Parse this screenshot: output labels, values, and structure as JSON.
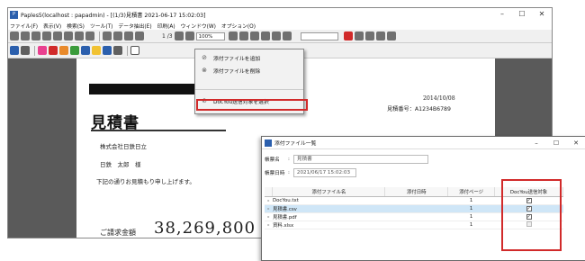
{
  "window": {
    "title": "Paples5(localhost : papadmin) - [(1/3)見積書 2021-06-17 15:02:03]",
    "controls": [
      "–",
      "☐",
      "✕"
    ]
  },
  "menubar": [
    "ファイル(F)",
    "表示(V)",
    "検索(S)",
    "ツール(T)",
    "データ抽出(E)",
    "印刷(A)",
    "ウィンドウ(W)",
    "オプション(O)"
  ],
  "toolbar": {
    "page_indicator": "1 /3",
    "zoom": "100%",
    "colors": {
      "pink": "#e9408f",
      "red": "#d12a2a",
      "orange": "#e98a2b",
      "yellow": "#f1c232",
      "green": "#3b9b3b",
      "blue": "#2b5fad",
      "gray": "#606060"
    }
  },
  "document": {
    "date": "2014/10/08",
    "number": "見積番号：A1234B6789",
    "title": "見積書",
    "company": "株式会社日鉄日立",
    "person": "日鉄　太郎　様",
    "sentence": "下記の通りお見積もり申し上げます。",
    "amount_label": "ご請求金額",
    "amount": "38,269,800"
  },
  "context_menu": {
    "items": [
      {
        "label": "添付ファイルを追加",
        "icon": "paperclip-icon"
      },
      {
        "label": "添付ファイルを削除",
        "icon": "paperclip-remove-icon"
      },
      {
        "label": "DocYou送信対象を選択",
        "icon": "paperclip-select-icon"
      }
    ]
  },
  "dialog": {
    "title": "添付ファイル一覧",
    "controls": [
      "–",
      "☐",
      "✕"
    ],
    "fields": {
      "doc_name_label": "帳票名",
      "doc_name_value": "見積書",
      "created_label": "帳票日時",
      "created_value": "2021/06/17 15:02:03"
    },
    "columns": [
      "添付ファイル名",
      "添付日時",
      "添付ページ",
      "DocYou送信対象"
    ],
    "rows": [
      {
        "name": "DocYou.txt",
        "date": "",
        "page": "1",
        "checked": "✓",
        "selected": false
      },
      {
        "name": "見積書.csv",
        "date": "",
        "page": "1",
        "checked": "✓",
        "selected": true
      },
      {
        "name": "見積書.pdf",
        "date": "",
        "page": "1",
        "checked": "✓",
        "selected": false
      },
      {
        "name": "資料.xlsx",
        "date": "",
        "page": "1",
        "checked": "",
        "selected": false
      }
    ]
  }
}
